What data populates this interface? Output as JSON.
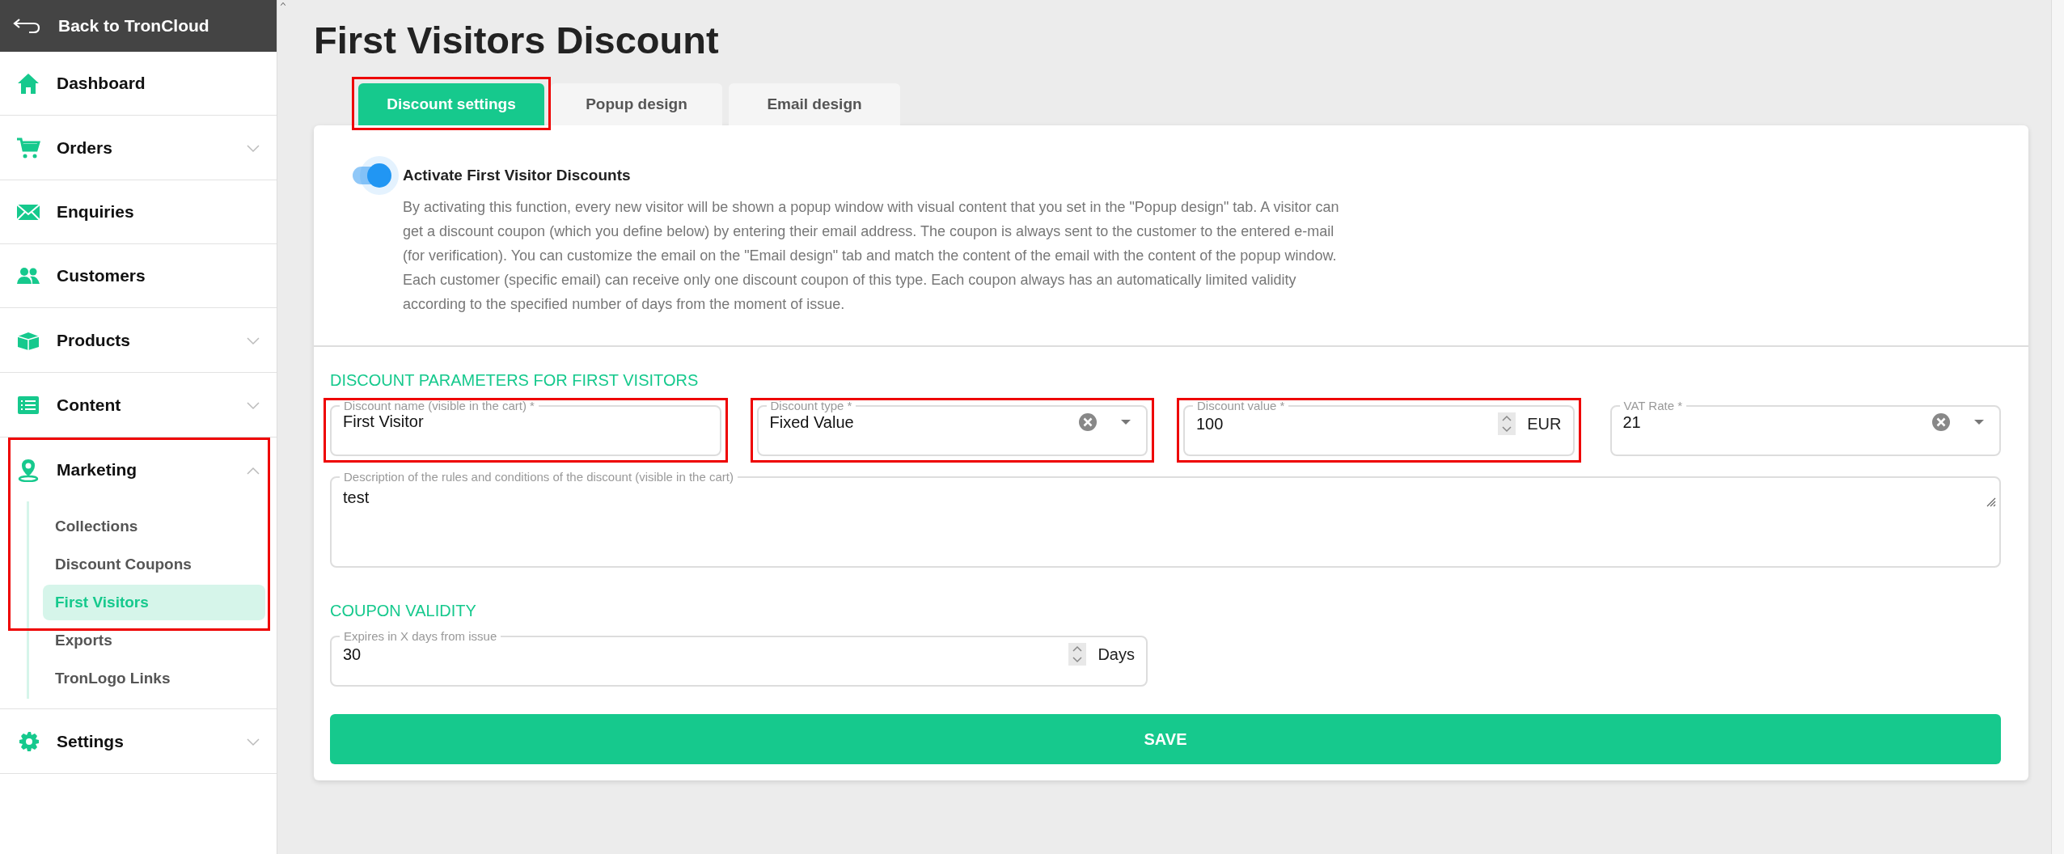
{
  "sidebar": {
    "back": {
      "label": "Back to TronCloud"
    },
    "items": [
      {
        "kind": "link",
        "label": "Dashboard"
      },
      {
        "kind": "group",
        "label": "Orders",
        "expanded": false
      },
      {
        "kind": "link",
        "label": "Enquiries"
      },
      {
        "kind": "link",
        "label": "Customers"
      },
      {
        "kind": "group",
        "label": "Products",
        "expanded": false
      },
      {
        "kind": "group",
        "label": "Content",
        "expanded": false
      },
      {
        "kind": "group",
        "label": "Marketing",
        "expanded": true,
        "highlighted": true,
        "children": [
          {
            "label": "Collections",
            "selected": false
          },
          {
            "label": "Discount Coupons",
            "selected": false
          },
          {
            "label": "First Visitors",
            "selected": true
          },
          {
            "label": "Exports",
            "selected": false
          },
          {
            "label": "TronLogo Links",
            "selected": false
          }
        ]
      },
      {
        "kind": "group",
        "label": "Settings",
        "expanded": false
      }
    ]
  },
  "page": {
    "title": "First Visitors Discount"
  },
  "tabs": [
    {
      "label": "Discount settings",
      "selected": true,
      "highlighted": true
    },
    {
      "label": "Popup design",
      "selected": false,
      "highlighted": false
    },
    {
      "label": "Email design",
      "selected": false,
      "highlighted": false
    }
  ],
  "activation": {
    "label": "Activate First Visitor Discounts",
    "on": true,
    "description": "By activating this function, every new visitor will be shown a popup window with visual content that you set in the \"Popup design\" tab. A visitor can get a discount coupon (which you define below) by entering their email address. The coupon is always sent to the customer to the entered e-mail (for verification). You can customize the email on the \"Email design\" tab and match the content of the email with the content of the popup window. Each customer (specific email) can receive only one discount coupon of this type. Each coupon always has an automatically limited validity according to the specified number of days from the moment of issue."
  },
  "sections": [
    {
      "title": "DISCOUNT PARAMETERS FOR FIRST VISITORS",
      "fields": [
        {
          "kind": "text",
          "label": "Discount name (visible in the cart) *",
          "value": "First Visitor",
          "highlighted": true
        },
        {
          "kind": "select",
          "label": "Discount type *",
          "value": "Fixed Value",
          "highlighted": true
        },
        {
          "kind": "number",
          "label": "Discount value *",
          "value": "100",
          "suffix": "EUR",
          "highlighted": true
        },
        {
          "kind": "select",
          "label": "VAT Rate *",
          "value": "21",
          "highlighted": false
        },
        {
          "kind": "textarea",
          "label": "Description of the rules and conditions of the discount (visible in the cart)",
          "value": "test",
          "highlighted": false
        }
      ]
    },
    {
      "title": "COUPON VALIDITY",
      "fields": [
        {
          "kind": "number",
          "label": "Expires in X days from issue",
          "value": "30",
          "suffix": "Days",
          "highlighted": false
        }
      ]
    }
  ],
  "save_button": {
    "label": "SAVE"
  }
}
